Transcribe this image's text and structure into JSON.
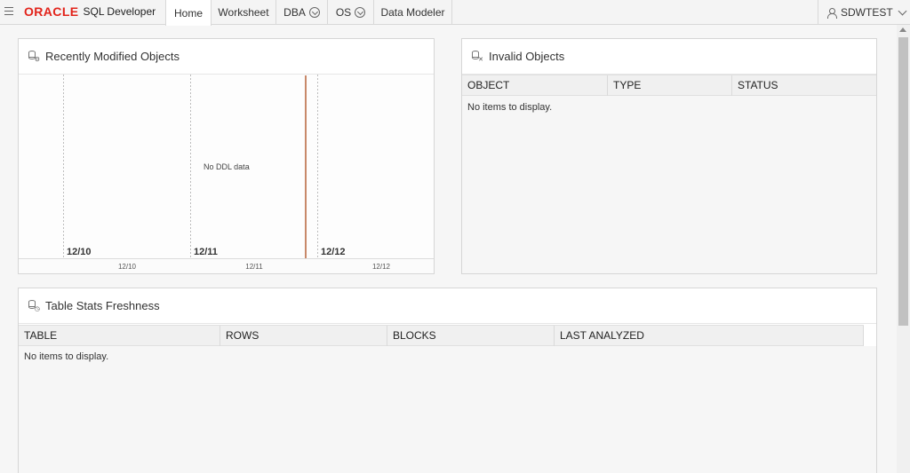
{
  "topbar": {
    "brand": "ORACLE",
    "product": "SQL Developer",
    "tabs": [
      {
        "label": "Home"
      },
      {
        "label": "Worksheet"
      },
      {
        "label": "DBA"
      },
      {
        "label": "OS"
      },
      {
        "label": "Data Modeler"
      }
    ],
    "user": "SDWTEST"
  },
  "recent": {
    "title": "Recently Modified Objects",
    "empty_text": "No DDL data",
    "columns": [
      "12/10",
      "12/11",
      "12/12"
    ]
  },
  "invalid": {
    "title": "Invalid Objects",
    "headers": [
      "OBJECT",
      "TYPE",
      "STATUS"
    ],
    "empty_text": "No items to display."
  },
  "stats": {
    "title": "Table Stats Freshness",
    "headers": [
      "TABLE",
      "ROWS",
      "BLOCKS",
      "LAST ANALYZED"
    ],
    "empty_text": "No items to display."
  },
  "colors": {
    "brand_red": "#e2231a",
    "now_marker": "#c8896a"
  },
  "icons": [
    "menu-icon",
    "database-icon",
    "user-icon",
    "chevron-down-icon"
  ]
}
